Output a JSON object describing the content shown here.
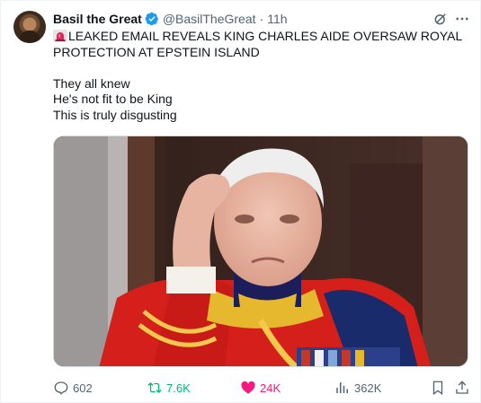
{
  "author": {
    "display_name": "Basil the Great",
    "handle": "@BasilTheGreat",
    "separator": "·",
    "time": "11h",
    "verified_color": "#1d9bf0",
    "avatar_icon": "avatar-portrait"
  },
  "post": {
    "headline_emoji": "rotating-light-icon",
    "headline": "LEAKED EMAIL REVEALS KING CHARLES AIDE OVERSAW ROYAL PROTECTION AT EPSTEIN ISLAND",
    "lines": [
      "They all knew",
      "He's not fit to be King",
      "This is truly disgusting"
    ]
  },
  "media": {
    "type": "photo"
  },
  "actions": {
    "reply": {
      "icon": "reply-icon",
      "count": "602"
    },
    "retweet": {
      "icon": "retweet-icon",
      "count": "7.6K",
      "color": "#00ba7c"
    },
    "like": {
      "icon": "heart-icon",
      "count": "24K",
      "color": "#f91880",
      "liked": true
    },
    "views": {
      "icon": "views-icon",
      "count": "362K"
    },
    "bookmark": {
      "icon": "bookmark-icon"
    },
    "share": {
      "icon": "share-icon"
    }
  },
  "colors": {
    "text_primary": "#0f1419",
    "text_secondary": "#536471",
    "border": "#cfd9de"
  }
}
